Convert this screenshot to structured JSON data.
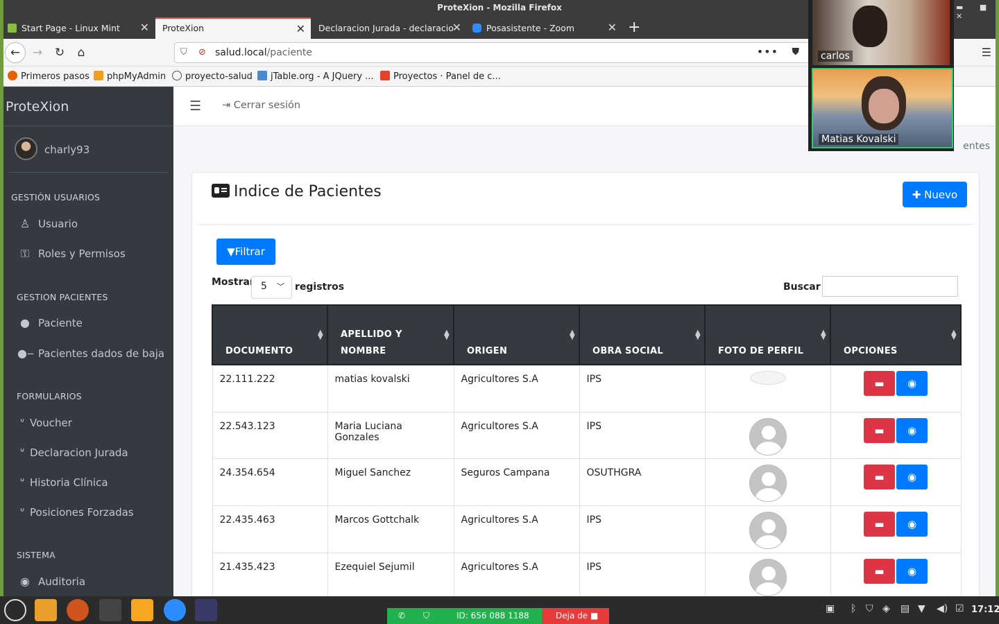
{
  "window": {
    "title": "ProteXion - Mozilla Firefox"
  },
  "tabs": [
    {
      "label": "Start Page - Linux Mint"
    },
    {
      "label": "ProteXion"
    },
    {
      "label": "Declaracion Jurada - declaracio"
    },
    {
      "label": "Posasistente - Zoom"
    }
  ],
  "urlbar": {
    "host": "salud.local",
    "path": "/paciente"
  },
  "bookmarks": [
    {
      "label": "Primeros pasos"
    },
    {
      "label": "phpMyAdmin"
    },
    {
      "label": "proyecto-salud"
    },
    {
      "label": "jTable.org - A JQuery ..."
    },
    {
      "label": "Proyectos · Panel de c..."
    }
  ],
  "sidebar": {
    "brand": "ProteXion",
    "username": "charly93",
    "sections": [
      {
        "title": "GESTIÒN USUARIOS",
        "items": [
          "Usuario",
          "Roles y Permisos"
        ]
      },
      {
        "title": "GESTION PACIENTES",
        "items": [
          "Paciente",
          "Pacientes dados de baja"
        ]
      },
      {
        "title": "FORMULARIOS",
        "items": [
          "Voucher",
          "Declaracion Jurada",
          "Historia Clínica",
          "Posiciones Forzadas"
        ]
      },
      {
        "title": "SISTEMA",
        "items": [
          "Auditoria"
        ]
      }
    ]
  },
  "topnav": {
    "logout": "Cerrar sesión"
  },
  "breadcrumb": "entes",
  "card": {
    "title": "Indice de Pacientes",
    "new_button": "Nuevo",
    "filter_button": "Filtrar"
  },
  "datatable": {
    "show_label": "Mostrar",
    "length_value": "5",
    "records_label": "registros",
    "search_label": "Buscar",
    "search_value": "",
    "columns": [
      "DOCUMENTO",
      "APELLIDO Y NOMBRE",
      "ORIGEN",
      "OBRA SOCIAL",
      "FOTO DE PERFIL",
      "OPCIONES"
    ],
    "rows": [
      {
        "documento": "22.111.222",
        "nombre": "matias kovalski",
        "origen": "Agricultores S.A",
        "obra_social": "IPS"
      },
      {
        "documento": "22.543.123",
        "nombre": "Maria Luciana Gonzales",
        "origen": "Agricultores S.A",
        "obra_social": "IPS"
      },
      {
        "documento": "24.354.654",
        "nombre": "Miguel Sanchez",
        "origen": "Seguros Campana",
        "obra_social": "OSUTHGRA"
      },
      {
        "documento": "22.435.463",
        "nombre": "Marcos Gottchalk",
        "origen": "Agricultores S.A",
        "obra_social": "IPS"
      },
      {
        "documento": "21.435.423",
        "nombre": "Ezequiel Sejumil",
        "origen": "Agricultores S.A",
        "obra_social": "IPS"
      }
    ]
  },
  "zoom": {
    "participants": [
      {
        "name": "carlos"
      },
      {
        "name": "Matias Kovalski"
      }
    ],
    "meeting_id": "ID: 656 088 1188",
    "stop_share": "Deja de"
  },
  "taskbar": {
    "clock": "17:12"
  },
  "colors": {
    "primary": "#007bff",
    "danger": "#dc3545",
    "sidebar": "#343a40",
    "zoom_green": "#23b14d"
  }
}
